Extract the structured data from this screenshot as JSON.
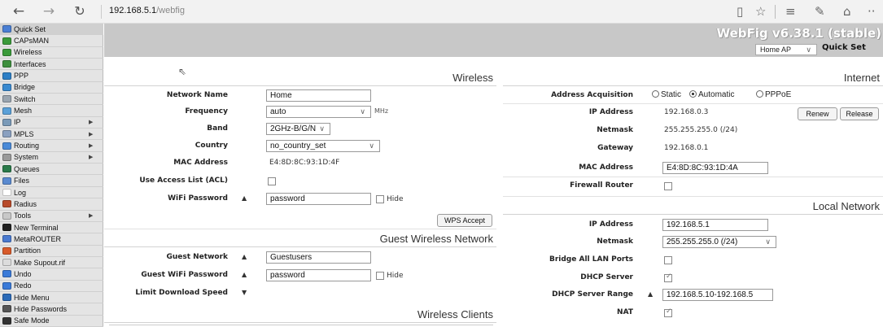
{
  "browser": {
    "url_host": "192.168.5.1",
    "url_path": "/webfig"
  },
  "header": {
    "product": "WebFig v6.38.1 (stable)",
    "mode_select": "Home AP",
    "title": "Quick Set"
  },
  "sidebar": {
    "items": [
      {
        "label": "Quick Set",
        "icon": "quick-set-icon",
        "color": "#4a7fd4",
        "arrow": false
      },
      {
        "label": "CAPsMAN",
        "icon": "capsman-icon",
        "color": "#3a9a3a",
        "arrow": false
      },
      {
        "label": "Wireless",
        "icon": "wireless-icon",
        "color": "#3a9a3a",
        "arrow": false
      },
      {
        "label": "Interfaces",
        "icon": "interfaces-icon",
        "color": "#3e8f3e",
        "arrow": false
      },
      {
        "label": "PPP",
        "icon": "ppp-icon",
        "color": "#2d7fc6",
        "arrow": false
      },
      {
        "label": "Bridge",
        "icon": "bridge-icon",
        "color": "#3a8ad0",
        "arrow": false
      },
      {
        "label": "Switch",
        "icon": "switch-icon",
        "color": "#9aa5b0",
        "arrow": false
      },
      {
        "label": "Mesh",
        "icon": "mesh-icon",
        "color": "#5aa0d8",
        "arrow": false
      },
      {
        "label": "IP",
        "icon": "ip-icon",
        "color": "#7a9ab8",
        "arrow": true
      },
      {
        "label": "MPLS",
        "icon": "mpls-icon",
        "color": "#8aa0c0",
        "arrow": true
      },
      {
        "label": "Routing",
        "icon": "routing-icon",
        "color": "#4a8ad8",
        "arrow": true
      },
      {
        "label": "System",
        "icon": "system-icon",
        "color": "#9a9a9a",
        "arrow": true
      },
      {
        "label": "Queues",
        "icon": "queues-icon",
        "color": "#2a7a4a",
        "arrow": false
      },
      {
        "label": "Files",
        "icon": "files-icon",
        "color": "#5a8ad0",
        "arrow": false
      },
      {
        "label": "Log",
        "icon": "log-icon",
        "color": "#ffffff",
        "arrow": false
      },
      {
        "label": "Radius",
        "icon": "radius-icon",
        "color": "#b84a2a",
        "arrow": false
      },
      {
        "label": "Tools",
        "icon": "tools-icon",
        "color": "#c8c8c8",
        "arrow": true
      },
      {
        "label": "New Terminal",
        "icon": "terminal-icon",
        "color": "#222222",
        "arrow": false
      },
      {
        "label": "MetaROUTER",
        "icon": "metarouter-icon",
        "color": "#4a7ad0",
        "arrow": false
      },
      {
        "label": "Partition",
        "icon": "partition-icon",
        "color": "#d85a2a",
        "arrow": false
      },
      {
        "label": "Make Supout.rif",
        "icon": "supout-icon",
        "color": "#dcdcdc",
        "arrow": false
      },
      {
        "label": "Undo",
        "icon": "undo-icon",
        "color": "#3a7ad8",
        "arrow": false
      },
      {
        "label": "Redo",
        "icon": "redo-icon",
        "color": "#3a7ad8",
        "arrow": false
      },
      {
        "label": "Hide Menu",
        "icon": "hide-menu-icon",
        "color": "#2a6ab8",
        "arrow": false
      },
      {
        "label": "Hide Passwords",
        "icon": "hide-passwords-icon",
        "color": "#555555",
        "arrow": false
      },
      {
        "label": "Safe Mode",
        "icon": "safe-mode-icon",
        "color": "#333333",
        "arrow": false
      }
    ]
  },
  "wireless": {
    "heading": "Wireless",
    "network_name_label": "Network Name",
    "network_name": "Home",
    "frequency_label": "Frequency",
    "frequency": "auto",
    "frequency_unit": "MHz",
    "band_label": "Band",
    "band": "2GHz-B/G/N",
    "country_label": "Country",
    "country": "no_country_set",
    "mac_label": "MAC Address",
    "mac": "E4:8D:8C:93:1D:4F",
    "acl_label": "Use Access List (ACL)",
    "acl_checked": false,
    "wifi_password_label": "WiFi Password",
    "wifi_password": "password",
    "hide_label": "Hide",
    "wps_button": "WPS Accept"
  },
  "guest": {
    "heading": "Guest Wireless Network",
    "guest_network_label": "Guest Network",
    "guest_network": "Guestusers",
    "guest_password_label": "Guest WiFi Password",
    "guest_password": "password",
    "hide_label": "Hide",
    "limit_label": "Limit Download Speed"
  },
  "clients": {
    "heading": "Wireless Clients"
  },
  "internet": {
    "heading": "Internet",
    "acq_label": "Address Acquisition",
    "acq_options": [
      "Static",
      "Automatic",
      "PPPoE"
    ],
    "acq_selected": "Automatic",
    "ip_label": "IP Address",
    "ip": "192.168.0.3",
    "renew_button": "Renew",
    "release_button": "Release",
    "netmask_label": "Netmask",
    "netmask": "255.255.255.0 (/24)",
    "gateway_label": "Gateway",
    "gateway": "192.168.0.1",
    "mac_label": "MAC Address",
    "mac": "E4:8D:8C:93:1D:4A",
    "firewall_label": "Firewall Router",
    "firewall_checked": false
  },
  "local": {
    "heading": "Local Network",
    "ip_label": "IP Address",
    "ip": "192.168.5.1",
    "netmask_label": "Netmask",
    "netmask": "255.255.255.0 (/24)",
    "bridge_label": "Bridge All LAN Ports",
    "bridge_checked": false,
    "dhcp_label": "DHCP Server",
    "dhcp_checked": true,
    "range_label": "DHCP Server Range",
    "range": "192.168.5.10-192.168.5",
    "nat_label": "NAT",
    "nat_checked": true
  }
}
